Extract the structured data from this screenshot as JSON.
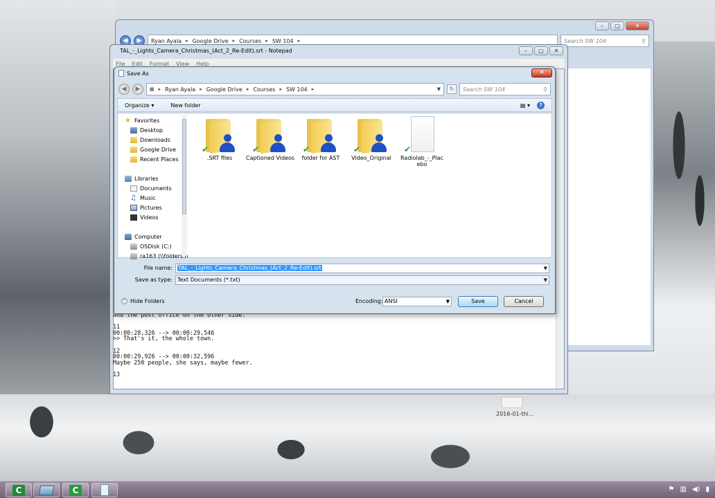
{
  "explorer": {
    "path": [
      "Ryan Ayala",
      "Google Drive",
      "Courses",
      "SW 104"
    ],
    "search_placeholder": "Search SW 104"
  },
  "notepad": {
    "title": "TAL_-_Lights_Camera_Christmas_(Act_2_Re-Edit).srt - Notepad",
    "menu": [
      "File",
      "Edit",
      "Format",
      "View",
      "Help"
    ],
    "text_lines": "and the post office on the other side.\n\n11\n00:00:28,326 --> 00:00:29,546\n>> That's it, the whole town.\n\n12\n00:00:29,926 --> 00:00:32,596\nMaybe 250 people, she says, maybe fewer.\n\n13"
  },
  "dialog": {
    "title": "Save As",
    "path": [
      "Ryan Ayala",
      "Google Drive",
      "Courses",
      "SW 104"
    ],
    "search_placeholder": "Search SW 104",
    "toolbar": {
      "organize": "Organize ▾",
      "new_folder": "New folder"
    },
    "nav": {
      "favorites": "Favorites",
      "desktop": "Desktop",
      "downloads": "Downloads",
      "google_drive": "Google Drive",
      "recent_places": "Recent Places",
      "libraries": "Libraries",
      "documents": "Documents",
      "music": "Music",
      "pictures": "Pictures",
      "videos": "Videos",
      "computer": "Computer",
      "osdisk": "OSDisk (C:)",
      "network": "ra163 (\\\\folders.h"
    },
    "files": [
      {
        "name": ".SRT files"
      },
      {
        "name": "Captioned Videos"
      },
      {
        "name": "folder for AST"
      },
      {
        "name": "Video_Original"
      },
      {
        "name": "Radiolab_-_Placebo"
      }
    ],
    "file_name_label": "File name:",
    "file_name_value": "TAL_-_Lights_Camera_Christmas_(Act_2_Re-Edit).srt",
    "save_type_label": "Save as type:",
    "save_type_value": "Text Documents (*.txt)",
    "hide_folders": "Hide Folders",
    "encoding_label": "Encoding:",
    "encoding_value": "ANSI",
    "save_label": "Save",
    "cancel_label": "Cancel"
  },
  "desktop": {
    "date_text": "2016-01-thi..."
  },
  "colors": {
    "accent": "#3399ff",
    "folder": "#f3cd55",
    "user_icon": "#1e50c8",
    "check": "#2e9a3a"
  }
}
